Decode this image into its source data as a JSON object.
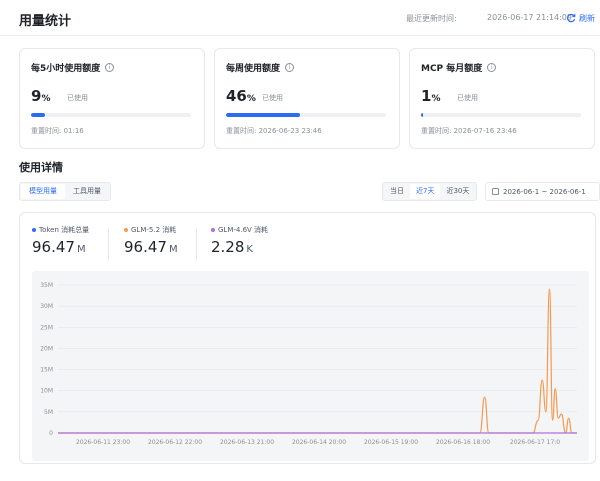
{
  "header": {
    "title": "用量统计",
    "update_label": "最近更新时间:",
    "update_time": "2026-06-17 21:14:09",
    "refresh_label": "刷新"
  },
  "colors": {
    "accent": "#2a6df4",
    "token": "#2a6df4",
    "glm52": "#f39a4f",
    "glm46v": "#b06fe0"
  },
  "quotas": [
    {
      "title": "每5小时使用额度",
      "percent": "9",
      "unit": "%",
      "used_label": "已使用",
      "progress": 0.09,
      "reset": "重置时间: 01:16"
    },
    {
      "title": "每周使用额度",
      "percent": "46",
      "unit": "%",
      "used_label": "已使用",
      "progress": 0.46,
      "reset": "重置时间: 2026-06-23 23:46"
    },
    {
      "title": "MCP 每月额度",
      "percent": "1",
      "unit": "%",
      "used_label": "已使用",
      "progress": 0.01,
      "reset": "重置时间: 2026-07-16 23:46"
    }
  ],
  "details": {
    "title": "使用详情",
    "tabs": [
      "模型用量",
      "工具用量"
    ],
    "ranges": [
      "当日",
      "近7天",
      "近30天"
    ],
    "date_range": "2026-06-1 ~ 2026-06-1"
  },
  "stats": [
    {
      "label": "Token 消耗总量",
      "value": "96.47",
      "unit": "M"
    },
    {
      "label": "GLM-5.2 消耗",
      "value": "96.47",
      "unit": "M"
    },
    {
      "label": "GLM-4.6V 消耗",
      "value": "2.28",
      "unit": "K"
    }
  ],
  "chart_data": {
    "type": "line",
    "x_ticks": [
      "2026-06-11 23:00",
      "2026-06-12 22:00",
      "2026-06-13 21:00",
      "2026-06-14 20:00",
      "2026-06-15 19:00",
      "2026-06-16 18:00",
      "2026-06-17 17:0"
    ],
    "y_ticks": [
      "0",
      "5M",
      "10M",
      "15M",
      "20M",
      "25M",
      "30M",
      "35M"
    ],
    "ylim": [
      0,
      35000000
    ],
    "series": [
      {
        "name": "GLM-5.2",
        "color": "#f39a4f",
        "points": [
          {
            "t": 0.0,
            "v": 0
          },
          {
            "t": 0.805,
            "v": 0
          },
          {
            "t": 0.813,
            "v": 0
          },
          {
            "t": 0.822,
            "v": 8500000
          },
          {
            "t": 0.83,
            "v": 0
          },
          {
            "t": 0.915,
            "v": 0
          },
          {
            "t": 0.925,
            "v": 3000000
          },
          {
            "t": 0.933,
            "v": 12500000
          },
          {
            "t": 0.94,
            "v": 5000000
          },
          {
            "t": 0.947,
            "v": 34000000
          },
          {
            "t": 0.953,
            "v": 3000000
          },
          {
            "t": 0.958,
            "v": 10500000
          },
          {
            "t": 0.964,
            "v": 3500000
          },
          {
            "t": 0.97,
            "v": 4500000
          },
          {
            "t": 0.978,
            "v": 0
          },
          {
            "t": 0.984,
            "v": 3500000
          },
          {
            "t": 0.99,
            "v": 0
          },
          {
            "t": 1.0,
            "v": 0
          }
        ]
      },
      {
        "name": "GLM-4.6V",
        "color": "#b06fe0",
        "points": [
          {
            "t": 0.0,
            "v": 0
          },
          {
            "t": 1.0,
            "v": 0
          }
        ]
      }
    ]
  }
}
